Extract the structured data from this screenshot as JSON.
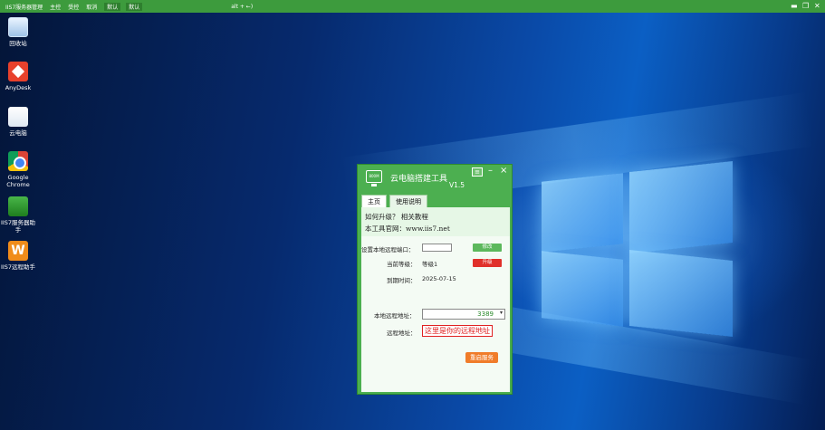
{
  "topbar": {
    "app_title": "IIS7服务器管理",
    "items": [
      "主控",
      "受控",
      "取消"
    ],
    "buttons": [
      "默认",
      "默认"
    ],
    "hotkey_hint": "alt + ←)",
    "controls": {
      "minimize": "▬",
      "restore": "❐",
      "close": "✕"
    }
  },
  "desktop": {
    "icons": [
      {
        "label": "回收站",
        "icon": "recycle-bin-icon"
      },
      {
        "label": "AnyDesk",
        "icon": "anydesk-icon"
      },
      {
        "label": "云电脑",
        "icon": "cloud-pc-icon"
      },
      {
        "label": "Google Chrome",
        "icon": "chrome-icon"
      },
      {
        "label": "IIS7服务器助手",
        "icon": "iis7-server-helper-icon"
      },
      {
        "label": "IIS7远程助手",
        "icon": "iis7-remote-helper-icon"
      }
    ]
  },
  "tool": {
    "logo_text": "800M",
    "title": "云电脑搭建工具",
    "version": "V1.5",
    "menu_icon": "≡",
    "minimize_icon": "–",
    "close_icon": "×",
    "tabs": [
      {
        "label": "主页",
        "active": true
      },
      {
        "label": "使用说明",
        "active": false
      }
    ],
    "upgrade_line": "如何升级？  相关教程",
    "website_line": "本工具官网：www.iis7.net",
    "port_label": "设置本地远程端口：",
    "port_value": "",
    "modify_button": "修改",
    "level_label": "当前等级：",
    "level_value": "等级1",
    "upgrade_button": "升级",
    "expiry_label": "到期时间：",
    "expiry_value": "2025-07-15",
    "local_address_label": "本地远程地址：",
    "local_address_value": "3389",
    "remote_address_label": "远程地址：",
    "remote_address_hint": "这里是你的远程地址",
    "restart_button": "重启服务"
  },
  "colors": {
    "toolbar_green": "#3d9b3d",
    "window_green": "#4caf50",
    "modify_button": "#5cb85c",
    "upgrade_button": "#e0302a",
    "restart_button": "#f07c2a"
  }
}
